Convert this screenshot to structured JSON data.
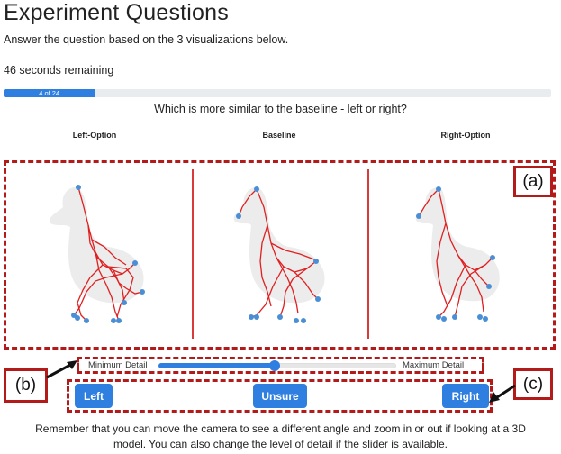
{
  "page": {
    "title": "Experiment Questions",
    "subtitle": "Answer the question based on the 3 visualizations below.",
    "timer": "46 seconds remaining",
    "progress": {
      "label": "4 of 24",
      "fraction": 0.1667
    },
    "question": "Which is more similar to the baseline - left or right?"
  },
  "columns": [
    "Left-Option",
    "Baseline",
    "Right-Option"
  ],
  "callouts": {
    "a": "(a)",
    "b": "(b)",
    "c": "(c)"
  },
  "slider": {
    "min_label": "Minimum Detail",
    "max_label": "Maximum Detail",
    "value": 0.48
  },
  "buttons": {
    "left": "Left",
    "unsure": "Unsure",
    "right": "Right"
  },
  "footer": {
    "line1": "Remember that you can move the camera to see a different angle and zoom in or out if looking at a 3D",
    "line2": "model. You can also change the level of detail if the slider is available."
  },
  "colors": {
    "accent": "#2f7fe0",
    "annotation": "#b31b1b",
    "skeleton": "#e02020",
    "joint": "#4a8fd6",
    "silhouette": "#ececec"
  }
}
